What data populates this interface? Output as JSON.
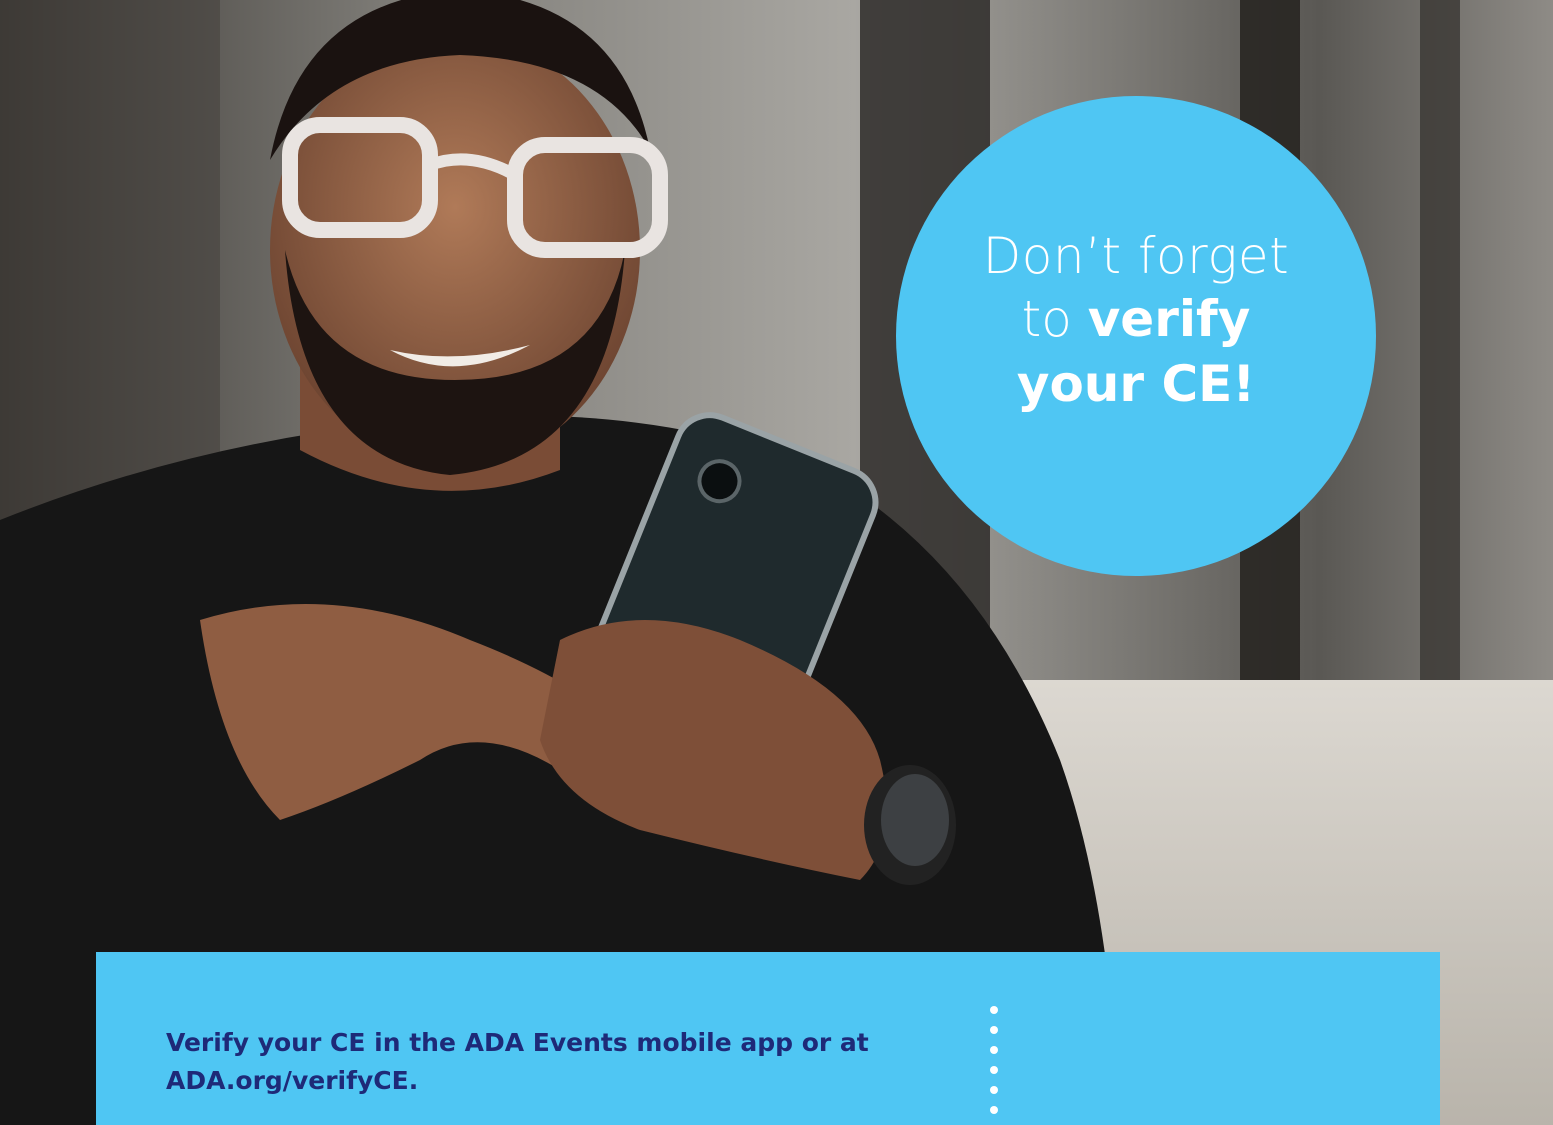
{
  "photo": {
    "subject": "man-using-smartphone-photo"
  },
  "callout": {
    "line1": "Don’t forget",
    "line2_light": "to ",
    "line2_bold": "verify",
    "line3": "your CE!",
    "color": "#4fc6f3"
  },
  "banner": {
    "text_line1": "Verify your CE in the ADA Events mobile app or at",
    "text_line2": "ADA.org/verifyCE.",
    "background": "#4fc6f3",
    "text_color": "#1e2a78"
  }
}
